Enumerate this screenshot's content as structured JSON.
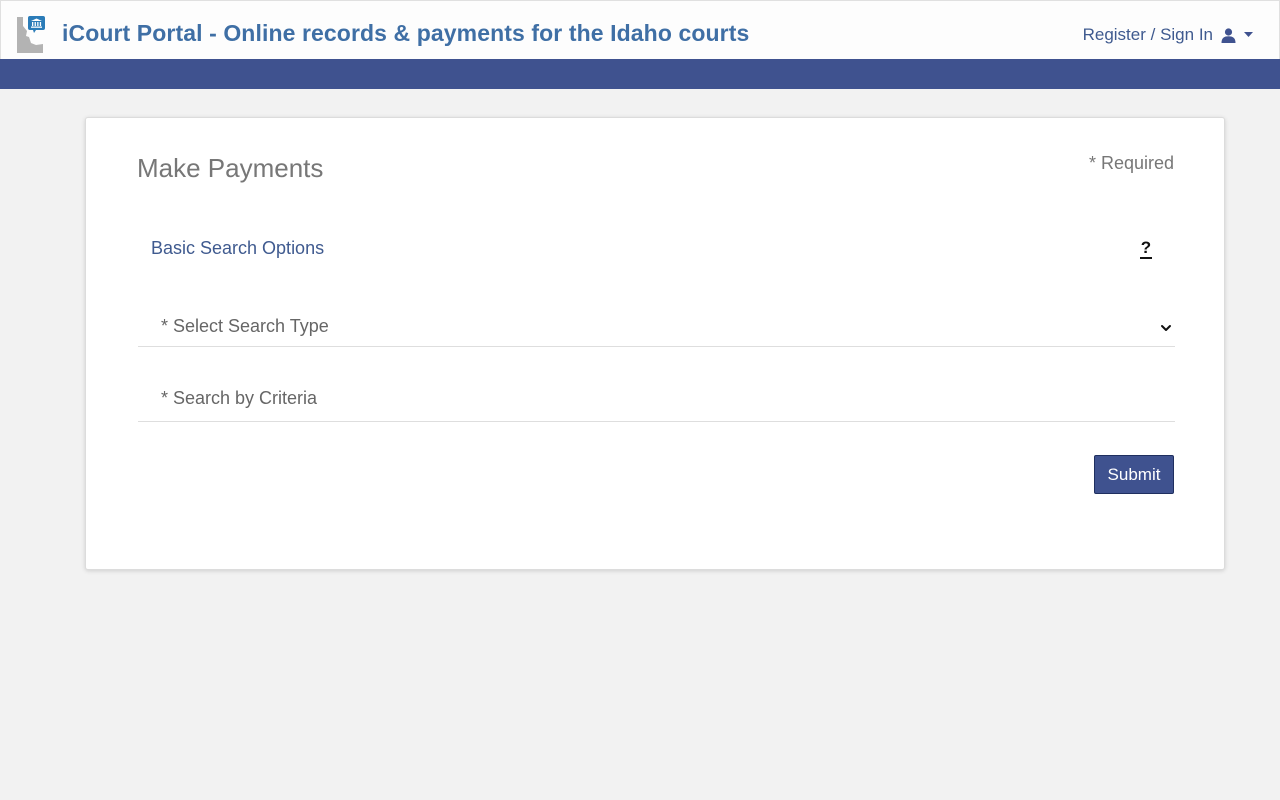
{
  "header": {
    "title": "iCourt Portal - Online records & payments for the Idaho courts",
    "logo_icon": "idaho-courthouse-logo-icon",
    "user_menu": {
      "label": "Register / Sign In",
      "icon": "user-icon",
      "caret_icon": "caret-down-icon"
    }
  },
  "colors": {
    "brand_blue": "#3f528f",
    "title_blue": "#3f6fa5",
    "background": "#f2f2f2"
  },
  "form": {
    "title": "Make Payments",
    "required_note": "* Required",
    "section_label": "Basic Search Options",
    "help_icon": "?",
    "search_type": {
      "label": "* Select Search Type",
      "icon": "chevron-down-icon"
    },
    "search_criteria": {
      "label": "* Search by Criteria"
    },
    "submit_label": "Submit"
  }
}
